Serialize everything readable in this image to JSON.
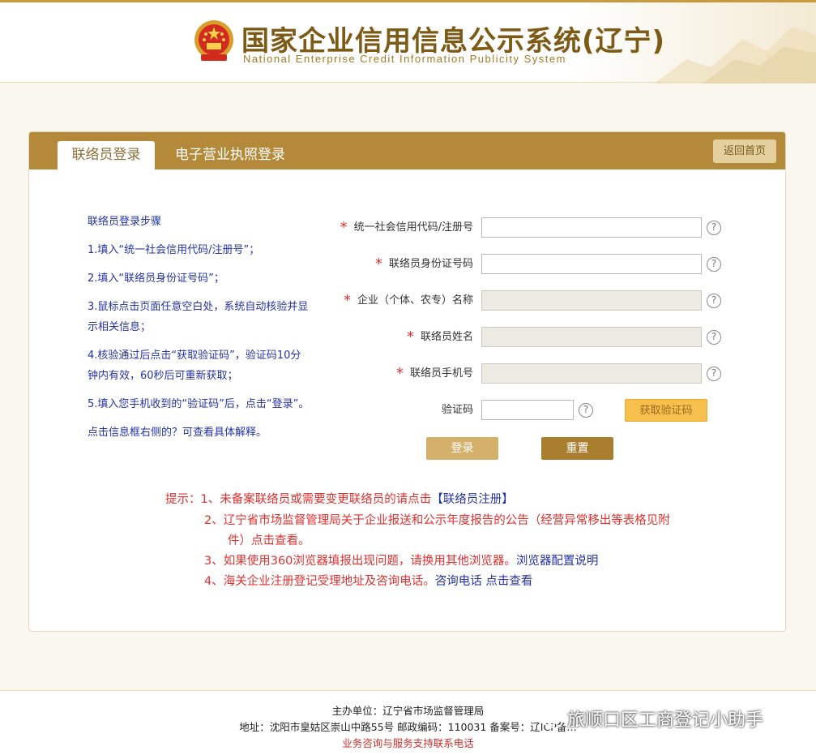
{
  "header": {
    "title": "国家企业信用信息公示系统(辽宁)",
    "subtitle": "National  Enterprise  Credit  Information  Publicity  System"
  },
  "tabs": {
    "active": "联络员登录",
    "other": "电子营业执照登录",
    "back_home": "返回首页"
  },
  "steps": {
    "heading": "联络员登录步骤",
    "items": [
      "1.填入“统一社会信用代码/注册号”；",
      "2.填入“联络员身份证号码”；",
      "3.鼠标点击页面任意空白处，系统自动核验并显示相关信息；",
      "4.核验通过后点击“获取验证码”，验证码10分钟内有效，60秒后可重新获取；",
      "5.填入您手机收到的“验证码”后，点击“登录”。"
    ],
    "hint": "点击信息框右侧的？可查看具体解释。"
  },
  "form": {
    "required_mark": "*",
    "help_symbol": "?",
    "fields": {
      "credit_code": {
        "label": "统一社会信用代码/注册号",
        "value": ""
      },
      "id_number": {
        "label": "联络员身份证号码",
        "value": ""
      },
      "company_name": {
        "label": "企业（个体、农专）名称",
        "value": ""
      },
      "contact_name": {
        "label": "联络员姓名",
        "value": ""
      },
      "contact_phone": {
        "label": "联络员手机号",
        "value": ""
      },
      "captcha": {
        "label": "验证码",
        "value": ""
      }
    },
    "get_captcha": "获取验证码",
    "login": "登录",
    "reset": "重置"
  },
  "notices": {
    "prefix": "提示：1、未备案联络员或需要变更联络员的请点击",
    "register_link": "【联络员注册】",
    "item2_line1": "2、辽宁省市场监督管理局关于企业报送和公示年度报告的公告（经营异常移出等表格见附",
    "item2_line2": "件）点击查看。",
    "item3_text": "3、如果使用360浏览器填报出现问题，请换用其他浏览器。",
    "item3_link": "浏览器配置说明",
    "item4_text": "4、海关企业注册登记受理地址及咨询电话。",
    "item4_link": "咨询电话 点击查看"
  },
  "footer": {
    "sponsor": "主办单位：辽宁省市场监督管理局",
    "address": "地址：沈阳市皇姑区崇山中路55号 邮政编码：110031 备案号：辽ICP备…",
    "support_link": "业务咨询与服务支持联系电话"
  },
  "watermark": {
    "text": "旅顺口区工商登记小助手"
  },
  "colors": {
    "accent": "#b48a3a",
    "link_blue": "#2433a6",
    "notice_red": "#e0312f",
    "captcha_button": "#f7bf4d"
  }
}
